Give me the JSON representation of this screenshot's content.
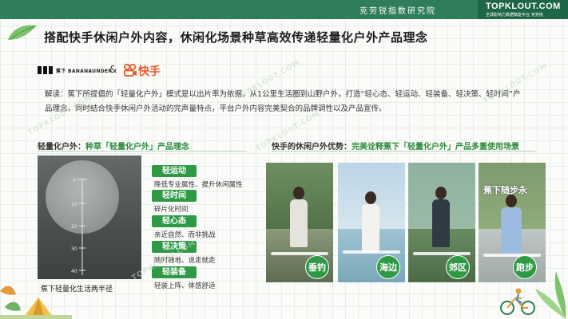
{
  "header": {
    "institute": "克劳锐指数研究院",
    "logo_main": "TOPKLOUT.COM",
    "logo_sub": "全球影响力数据赋能平台 克劳锐"
  },
  "title": "搭配快手休闲户外内容，休闲化场景种草高效传递轻量化户外产品理念",
  "brands": {
    "brand1_name": "蕉下 BANANAUNDER",
    "amp": "&",
    "brand2_name": "快手"
  },
  "intro": "解读：蕉下所提倡的「轻量化户外」模式是以出片率为依据，从1公里生活圈到山野户外，打造“轻心态、轻运动、轻装备、轻决策、轻时间”产品理念，同时结合快手休闲户外活动的完声量特点，平台户外内容完美契合的品牌调性以及产品宣传。",
  "left_section": {
    "heading_prefix": "轻量化户外：",
    "heading_highlight": "种草「轻量化户外」产品理念",
    "ruler_labels": [
      "0",
      "10",
      "20",
      "30",
      "40"
    ],
    "caption": "蕉下轻量化生活两半径",
    "tags": [
      {
        "label": "轻运动",
        "desc": "降低专业属性、提升休闲属性"
      },
      {
        "label": "轻时间",
        "desc": "碎片化时间"
      },
      {
        "label": "轻心态",
        "desc": "亲近自然、而非挑战"
      },
      {
        "label": "轻决策",
        "desc": "随时随地、说走就走"
      },
      {
        "label": "轻装备",
        "desc": "轻装上阵、体感舒适"
      }
    ]
  },
  "right_section": {
    "heading_prefix": "快手的休闲户外优势：",
    "heading_highlight": "完美诠释蕉下「轻量化户外」产品多重使用场景",
    "scenes": [
      {
        "label": "垂钓"
      },
      {
        "label": "海边"
      },
      {
        "label": "郊区"
      },
      {
        "label": "跑步"
      }
    ],
    "overlay_text": "蕉下随步永"
  },
  "watermark": "TOPKLOUT.COM",
  "colors": {
    "brand_green": "#2f7d5a",
    "tag_green": "#2f9a45",
    "kuaishou_orange": "#e8582b"
  }
}
